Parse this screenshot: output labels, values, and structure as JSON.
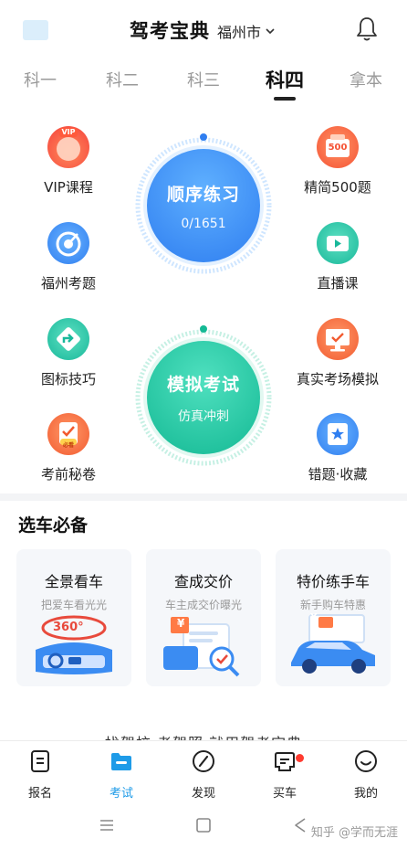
{
  "header": {
    "title": "驾考宝典",
    "city": "福州市"
  },
  "tabs": [
    {
      "label": "科一"
    },
    {
      "label": "科二"
    },
    {
      "label": "科三"
    },
    {
      "label": "科四",
      "active": true
    },
    {
      "label": "拿本"
    }
  ],
  "features_left": [
    {
      "label": "VIP课程",
      "icon": "vip-icon",
      "icon_text": "VIP",
      "color": "#f5573b"
    },
    {
      "label": "福州考题",
      "icon": "target-icon",
      "color": "#2f8cf0"
    },
    {
      "label": "图标技巧",
      "icon": "road-sign-icon",
      "color": "#1fbfa5"
    },
    {
      "label": "考前秘卷",
      "icon": "checklist-icon",
      "icon_text": "必看",
      "color": "#f56a36"
    }
  ],
  "features_right": [
    {
      "label": "精简500题",
      "icon": "500-badge-icon",
      "icon_text": "500",
      "color": "#f5623b"
    },
    {
      "label": "直播课",
      "icon": "video-icon",
      "color": "#1fbfa5"
    },
    {
      "label": "真实考场模拟",
      "icon": "monitor-icon",
      "color": "#f56a36"
    },
    {
      "label": "错题·收藏",
      "icon": "bookmark-icon",
      "color": "#2f8cf0"
    }
  ],
  "practice": {
    "title": "顺序练习",
    "progress": "0/1651",
    "color": "#2f8cf0"
  },
  "mock": {
    "title": "模拟考试",
    "subtitle": "仿真冲刺",
    "color": "#19c2a0"
  },
  "section": {
    "title": "选车必备"
  },
  "cards": [
    {
      "title": "全景看车",
      "subtitle": "把爱车看光光",
      "badge": "360°"
    },
    {
      "title": "查成交价",
      "subtitle": "车主成交价曝光",
      "badge": "¥"
    },
    {
      "title": "特价练手车",
      "subtitle": "新手购车特惠",
      "badge": "¥"
    }
  ],
  "peek_text": "找驾校  考驾照  就用驾考宝典",
  "bottom_nav": [
    {
      "label": "报名",
      "icon": "signup-icon"
    },
    {
      "label": "考试",
      "icon": "folder-icon",
      "active": true
    },
    {
      "label": "发现",
      "icon": "compass-icon"
    },
    {
      "label": "买车",
      "icon": "car-icon",
      "badge_dot": true
    },
    {
      "label": "我的",
      "icon": "smile-icon"
    }
  ],
  "watermark": "知乎 @学而无涯",
  "colors": {
    "accent": "#1e9be8",
    "blue": "#2f8cf0",
    "teal": "#19c2a0",
    "orange": "#f56a36"
  }
}
